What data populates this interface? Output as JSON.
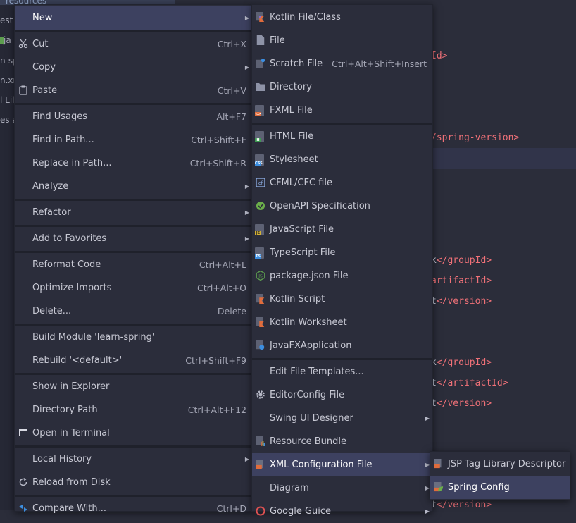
{
  "tree": {
    "top_label": "resources",
    "items": [
      "est",
      "ja",
      "n-sp",
      "n.xm",
      "l Lil",
      "es a"
    ]
  },
  "editor": {
    "lines": [
      {
        "pre": "",
        "tag": "Id>",
        "post": ""
      },
      {
        "pre": "",
        "tag": "/spring-version>",
        "post": ""
      },
      {
        "pre": "k",
        "tag": "</groupId>",
        "post": ""
      },
      {
        "pre": "",
        "tag": "artifactId>",
        "post": ""
      },
      {
        "pre": "t",
        "tag": "</version>",
        "post": ""
      },
      {
        "pre": "k",
        "tag": "</groupId>",
        "post": ""
      },
      {
        "pre": "t",
        "tag": "</artifactId>",
        "post": ""
      },
      {
        "pre": "t",
        "tag": "</version>",
        "post": ""
      },
      {
        "pre": "t",
        "tag": "</version>",
        "post": ""
      }
    ]
  },
  "context_menu": [
    {
      "label": "New",
      "shortcut": "",
      "submenu": true
    },
    {
      "label": "Cut",
      "shortcut": "Ctrl+X"
    },
    {
      "label": "Copy",
      "shortcut": "",
      "submenu": true
    },
    {
      "label": "Paste",
      "shortcut": "Ctrl+V"
    },
    {
      "label": "Find Usages",
      "shortcut": "Alt+F7"
    },
    {
      "label": "Find in Path...",
      "shortcut": "Ctrl+Shift+F"
    },
    {
      "label": "Replace in Path...",
      "shortcut": "Ctrl+Shift+R"
    },
    {
      "label": "Analyze",
      "shortcut": "",
      "submenu": true
    },
    {
      "label": "Refactor",
      "shortcut": "",
      "submenu": true
    },
    {
      "label": "Add to Favorites",
      "shortcut": "",
      "submenu": true
    },
    {
      "label": "Reformat Code",
      "shortcut": "Ctrl+Alt+L"
    },
    {
      "label": "Optimize Imports",
      "shortcut": "Ctrl+Alt+O"
    },
    {
      "label": "Delete...",
      "shortcut": "Delete"
    },
    {
      "label": "Build Module 'learn-spring'",
      "shortcut": ""
    },
    {
      "label": "Rebuild '<default>'",
      "shortcut": "Ctrl+Shift+F9"
    },
    {
      "label": "Show in Explorer",
      "shortcut": ""
    },
    {
      "label": "Directory Path",
      "shortcut": "Ctrl+Alt+F12"
    },
    {
      "label": "Open in Terminal",
      "shortcut": ""
    },
    {
      "label": "Local History",
      "shortcut": "",
      "submenu": true
    },
    {
      "label": "Reload from Disk",
      "shortcut": ""
    },
    {
      "label": "Compare With...",
      "shortcut": "Ctrl+D"
    }
  ],
  "new_submenu": [
    {
      "label": "Kotlin File/Class"
    },
    {
      "label": "File"
    },
    {
      "label": "Scratch File",
      "shortcut": "Ctrl+Alt+Shift+Insert"
    },
    {
      "label": "Directory"
    },
    {
      "label": "FXML File"
    },
    {
      "label": "HTML File"
    },
    {
      "label": "Stylesheet"
    },
    {
      "label": "CFML/CFC file"
    },
    {
      "label": "OpenAPI Specification"
    },
    {
      "label": "JavaScript File"
    },
    {
      "label": "TypeScript File"
    },
    {
      "label": "package.json File"
    },
    {
      "label": "Kotlin Script"
    },
    {
      "label": "Kotlin Worksheet"
    },
    {
      "label": "JavaFXApplication"
    },
    {
      "label": "Edit File Templates..."
    },
    {
      "label": "EditorConfig File"
    },
    {
      "label": "Swing UI Designer"
    },
    {
      "label": "Resource Bundle"
    },
    {
      "label": "XML Configuration File"
    },
    {
      "label": "Diagram"
    },
    {
      "label": "Google Guice"
    }
  ],
  "xml_submenu": [
    {
      "label": "JSP Tag Library Descriptor"
    },
    {
      "label": "Spring Config"
    }
  ],
  "icon_badges": {
    "fxml": "<>",
    "html": "H",
    "css": "CSS",
    "js": "JS",
    "ts": "TS"
  },
  "colors": {
    "highlight": "#3d4160",
    "menu_bg": "#2b2d3b",
    "tag": "#f07178"
  }
}
